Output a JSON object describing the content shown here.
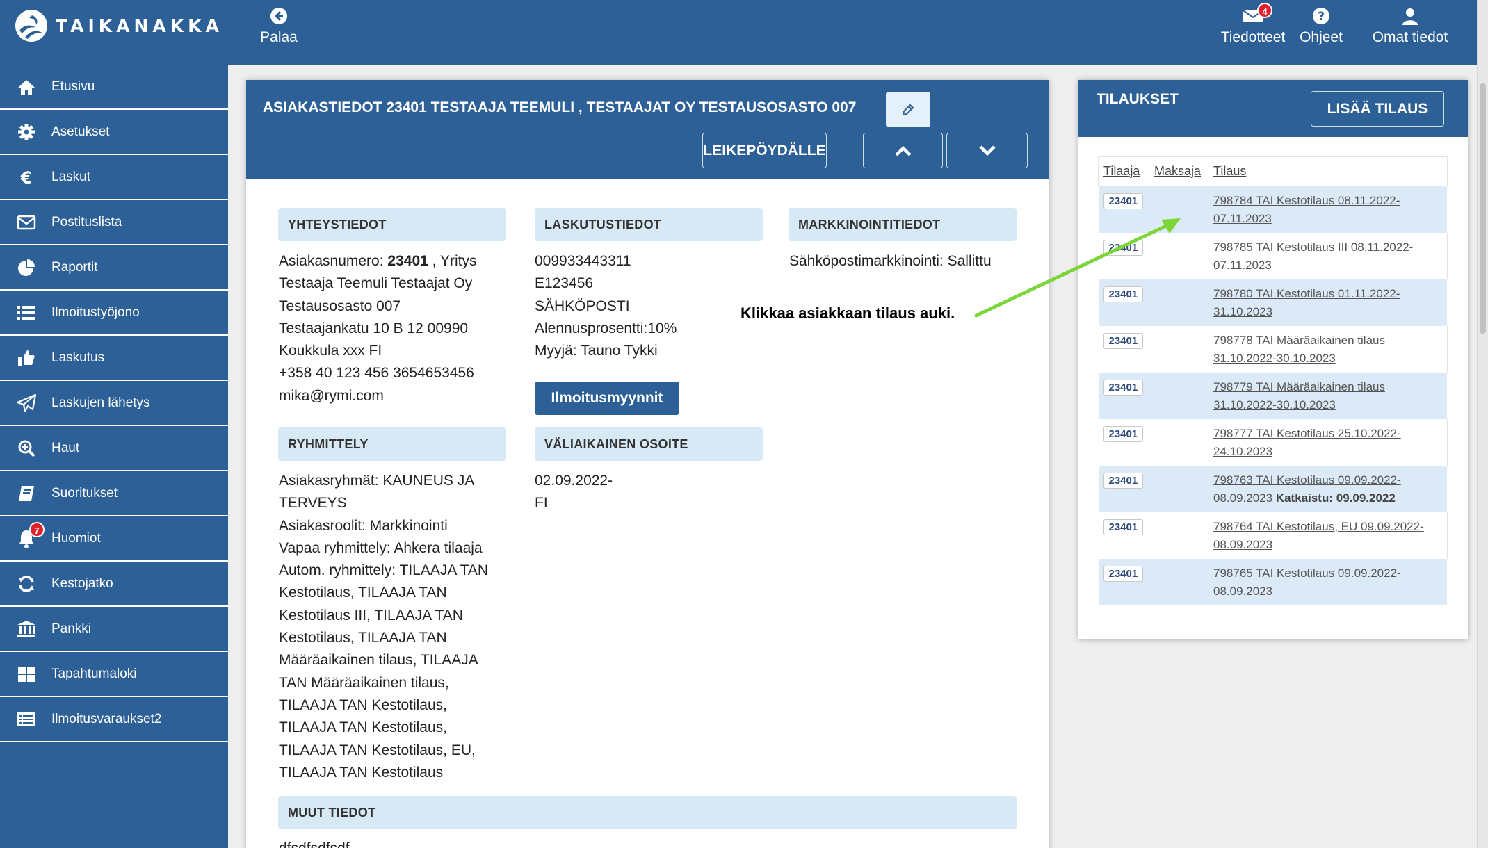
{
  "brand": {
    "name": "TAIKANAKKA"
  },
  "topbar": {
    "back_label": "Palaa",
    "messages_label": "Tiedotteet",
    "messages_badge": "4",
    "help_label": "Ohjeet",
    "profile_label": "Omat tiedot"
  },
  "sidebar": {
    "items": [
      {
        "label": "Etusivu",
        "icon": "home-icon"
      },
      {
        "label": "Asetukset",
        "icon": "gear-icon"
      },
      {
        "label": "Laskut",
        "icon": "euro-icon"
      },
      {
        "label": "Postituslista",
        "icon": "envelope-icon"
      },
      {
        "label": "Raportit",
        "icon": "pie-chart-icon"
      },
      {
        "label": "Ilmoitustyöjono",
        "icon": "list-icon"
      },
      {
        "label": "Laskutus",
        "icon": "thumbs-up-icon"
      },
      {
        "label": "Laskujen lähetys",
        "icon": "paper-plane-icon"
      },
      {
        "label": "Haut",
        "icon": "zoom-in-icon"
      },
      {
        "label": "Suoritukset",
        "icon": "book-icon"
      },
      {
        "label": "Huomiot",
        "icon": "bell-icon",
        "badge": "7"
      },
      {
        "label": "Kestojatko",
        "icon": "refresh-icon"
      },
      {
        "label": "Pankki",
        "icon": "bank-icon"
      },
      {
        "label": "Tapahtumaloki",
        "icon": "grid-icon"
      },
      {
        "label": "Ilmoitusvaraukset2",
        "icon": "list-alt-icon"
      }
    ]
  },
  "customer": {
    "title": "ASIAKASTIEDOT 23401 TESTAAJA TEEMULI , TESTAAJAT OY TESTAUSOSASTO 007",
    "clipboard_label": "LEIKEPÖYDÄLLE",
    "contact": {
      "heading": "YHTEYSTIEDOT",
      "number_label": "Asiakasnumero:",
      "number": "23401",
      "lines": [
        ", Yritys",
        "Testaaja Teemuli Testaajat Oy",
        "Testausosasto 007",
        "Testaajankatu 10 B 12 00990",
        "Koukkula xxx FI",
        "+358 40 123 456 3654653456",
        "mika@rymi.com"
      ]
    },
    "billing": {
      "heading": "LASKUTUSTIEDOT",
      "lines": [
        "009933443311",
        "E123456",
        "SÄHKÖPOSTI",
        "Alennusprosentti:10%",
        "Myyjä: Tauno Tykki"
      ],
      "button_label": "Ilmoitusmyynnit"
    },
    "marketing": {
      "heading": "MARKKINOINTITIEDOT",
      "lines": [
        "Sähköpostimarkkinointi: Sallittu"
      ]
    },
    "grouping": {
      "heading": "RYHMITTELY",
      "lines": [
        "Asiakasryhmät: KAUNEUS JA",
        "TERVEYS",
        "Asiakasroolit: Markkinointi",
        "Vapaa ryhmittely: Ahkera tilaaja",
        "Autom. ryhmittely: TILAAJA TAN",
        "Kestotilaus, TILAAJA TAN",
        "Kestotilaus III, TILAAJA TAN",
        "Kestotilaus, TILAAJA TAN",
        "Määräaikainen tilaus, TILAAJA",
        "TAN Määräaikainen tilaus,",
        "TILAAJA TAN Kestotilaus,",
        "TILAAJA TAN Kestotilaus,",
        "TILAAJA TAN Kestotilaus, EU,",
        "TILAAJA TAN Kestotilaus"
      ]
    },
    "temp_address": {
      "heading": "VÄLIAIKAINEN OSOITE",
      "lines": [
        "02.09.2022-",
        "FI"
      ]
    },
    "other": {
      "heading": "MUUT TIEDOT",
      "text": "dfsdfsdfsdf"
    }
  },
  "orders": {
    "title": "TILAUKSET",
    "add_label": "LISÄÄ TILAUS",
    "columns": [
      "Tilaaja",
      "Maksaja",
      "Tilaus"
    ],
    "rows": [
      {
        "customer": "23401",
        "payer": "",
        "order": "798784 TAI Kestotilaus 08.11.2022-",
        "order2": "07.11.2023",
        "note": ""
      },
      {
        "customer": "23401",
        "payer": "",
        "order": "798785 TAI Kestotilaus III 08.11.2022-",
        "order2": "07.11.2023",
        "note": ""
      },
      {
        "customer": "23401",
        "payer": "",
        "order": "798780 TAI Kestotilaus 01.11.2022-",
        "order2": "31.10.2023",
        "note": ""
      },
      {
        "customer": "23401",
        "payer": "",
        "order": "798778 TAI Määräaikainen tilaus",
        "order2": "31.10.2022-30.10.2023",
        "note": ""
      },
      {
        "customer": "23401",
        "payer": "",
        "order": "798779 TAI Määräaikainen tilaus",
        "order2": "31.10.2022-30.10.2023",
        "note": ""
      },
      {
        "customer": "23401",
        "payer": "",
        "order": "798777 TAI Kestotilaus 25.10.2022-",
        "order2": "24.10.2023",
        "note": ""
      },
      {
        "customer": "23401",
        "payer": "",
        "order": "798763 TAI Kestotilaus 09.09.2022-",
        "order2": "08.09.2023",
        "note": "Katkaistu: 09.09.2022"
      },
      {
        "customer": "23401",
        "payer": "",
        "order": "798764 TAI Kestotilaus, EU 09.09.2022-",
        "order2": "08.09.2023",
        "note": ""
      },
      {
        "customer": "23401",
        "payer": "",
        "order": "798765 TAI Kestotilaus 09.09.2022-",
        "order2": "08.09.2023",
        "note": ""
      }
    ]
  },
  "annotation": {
    "text": "Klikkaa asiakkaan tilaus auki.",
    "color": "#7cd63a"
  },
  "colors": {
    "primary": "#2d6097",
    "section_bg": "#d8e9f6",
    "badge": "#e0202a"
  }
}
